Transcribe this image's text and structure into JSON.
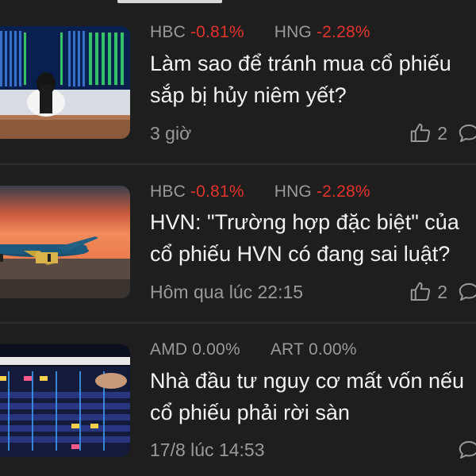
{
  "news_feed": [
    {
      "tickers": [
        {
          "symbol": "HBC",
          "change": "-0.81%",
          "direction": "down"
        },
        {
          "symbol": "HNG",
          "change": "-2.28%",
          "direction": "down"
        }
      ],
      "title_lines": [
        "Làm sao để tránh mua cổ phiếu",
        "sắp bị hủy niêm yết?"
      ],
      "time": "3 giờ",
      "likes": "2",
      "thumbnail_icon": "stock-board-person-image"
    },
    {
      "tickers": [
        {
          "symbol": "HBC",
          "change": "-0.81%",
          "direction": "down"
        },
        {
          "symbol": "HNG",
          "change": "-2.28%",
          "direction": "down"
        }
      ],
      "title_lines": [
        "HVN: \"Trường hợp đặc biệt\" của",
        "cổ phiếu HVN có đang sai luật?"
      ],
      "time": "Hôm qua lúc 22:15",
      "likes": "2",
      "thumbnail_icon": "airplane-sunset-image"
    },
    {
      "tickers": [
        {
          "symbol": "AMD",
          "change": "0.00%",
          "direction": "flat"
        },
        {
          "symbol": "ART",
          "change": "0.00%",
          "direction": "flat"
        }
      ],
      "title_lines": [
        "Nhà đầu tư nguy cơ mất vốn nếu",
        "cổ phiếu phải rời sàn"
      ],
      "time": "17/8 lúc 14:53",
      "likes": "",
      "thumbnail_icon": "upcom-board-image"
    }
  ],
  "colors": {
    "background": "#1e1e1e",
    "negative": "#e0342c",
    "muted": "#9a9a9a",
    "title": "#f2f2f2"
  }
}
